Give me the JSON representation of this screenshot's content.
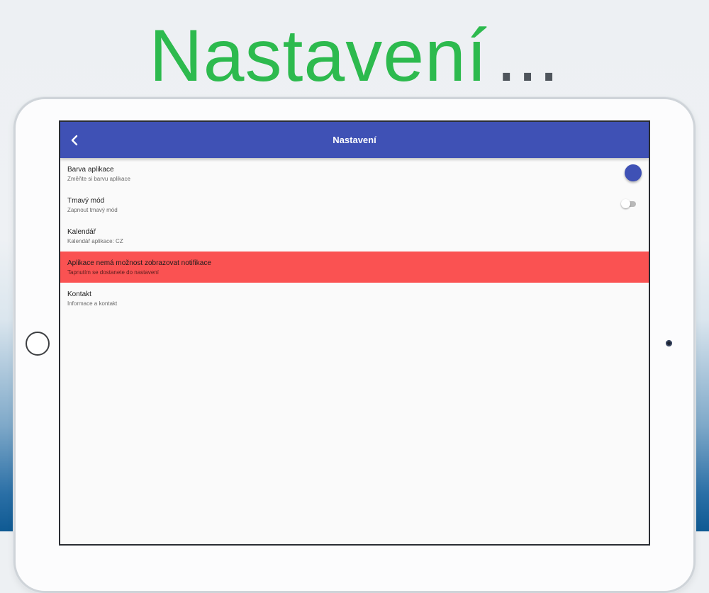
{
  "headline": {
    "word": "Nastavení",
    "dots": "..."
  },
  "appbar": {
    "title": "Nastavení"
  },
  "settings": [
    {
      "title": "Barva aplikace",
      "subtitle": "Změňte si barvu aplikace",
      "color": "#3f51b5"
    },
    {
      "title": "Tmavý mód",
      "subtitle": "Zapnout tmavý mód",
      "toggle_on": false
    },
    {
      "title": "Kalendář",
      "subtitle": "Kalendář aplikace: CZ"
    },
    {
      "title": "Aplikace nemá možnost zobrazovat notifikace",
      "subtitle": "Tapnutím se dostanete do nastavení",
      "highlight_color": "#fa5252"
    },
    {
      "title": "Kontakt",
      "subtitle": "Informace a kontakt"
    }
  ],
  "colors": {
    "accent": "#3f51b5",
    "headline_green": "#2dba4e",
    "alert": "#fa5252"
  },
  "icons": {
    "back": "chevron-left-icon"
  }
}
